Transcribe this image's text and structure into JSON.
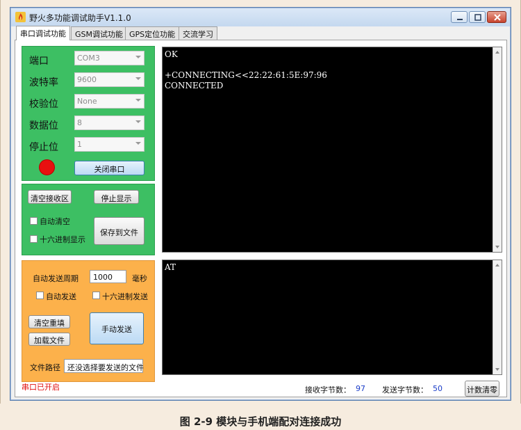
{
  "window": {
    "title": "野火多功能调试助手V1.1.0"
  },
  "tabs": [
    "串口调试功能",
    "GSM调试功能",
    "GPS定位功能",
    "交流学习"
  ],
  "serial_settings": {
    "port_label": "端口",
    "port_value": "COM3",
    "baud_label": "波特率",
    "baud_value": "9600",
    "parity_label": "校验位",
    "parity_value": "None",
    "databits_label": "数据位",
    "databits_value": "8",
    "stopbits_label": "停止位",
    "stopbits_value": "1",
    "status_color": "#e81010",
    "close_button": "关闭串口"
  },
  "receive_controls": {
    "clear_button": "清空接收区",
    "stop_button": "停止显示",
    "auto_clear_label": "自动清空",
    "hex_display_label": "十六进制显示",
    "save_button": "保存到文件"
  },
  "send_controls": {
    "period_label": "自动发送周期",
    "period_value": "1000",
    "period_unit": "毫秒",
    "auto_send_label": "自动发送",
    "hex_send_label": "十六进制发送",
    "clear_fill_button": "清空重填",
    "load_file_button": "加载文件",
    "manual_send_button": "手动发送",
    "file_path_label": "文件路径",
    "file_path_value": "还没选择要发送的文件"
  },
  "receive_area": {
    "lines": "OK\n\n+CONNECTING<<22:22:61:5E:97:96\nCONNECTED"
  },
  "send_area": {
    "text": "AT"
  },
  "status_bar": {
    "port_status": "串口已开启",
    "rx_label": "接收字节数：",
    "rx_count": "97",
    "tx_label": "发送字节数：",
    "tx_count": "50",
    "reset_button": "计数清零"
  },
  "caption": "图 2-9 模块与手机端配对连接成功"
}
